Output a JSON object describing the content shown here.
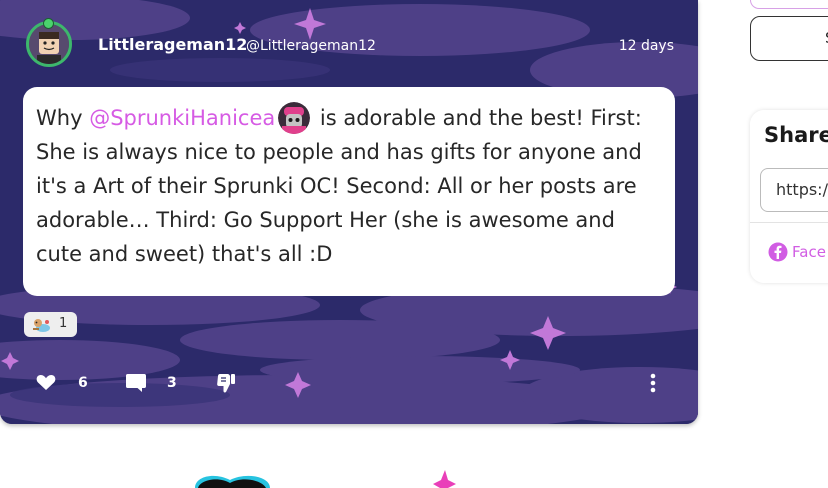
{
  "post": {
    "author_name": "Littlerageman12",
    "author_handle": "@Littlerageman12",
    "time": "12 days",
    "text_intro": "Why ",
    "mention": "@SprunkiHanicea",
    "text_body": " is adorable and the best! First: She is always nice to people and has gifts for anyone and it's a Art of their Sprunki OC! Second: All or her posts are adorable… Third: Go Support Her (she is awesome and cute and sweet) that's all :D",
    "reaction_count": "1",
    "like_count": "6",
    "comment_count": "3",
    "icons": {
      "like": "heart-icon",
      "comment": "speech-bubble-icon",
      "dislike": "thumbs-down-icon",
      "more": "more-vertical-icon"
    }
  },
  "sidebar": {
    "button_label": "S",
    "share_title": "Share",
    "share_url": "https:/",
    "facebook_label": "Face"
  },
  "colors": {
    "card_bg": "#2c2a6a",
    "mention": "#d65be4",
    "accent": "#d15de3"
  }
}
